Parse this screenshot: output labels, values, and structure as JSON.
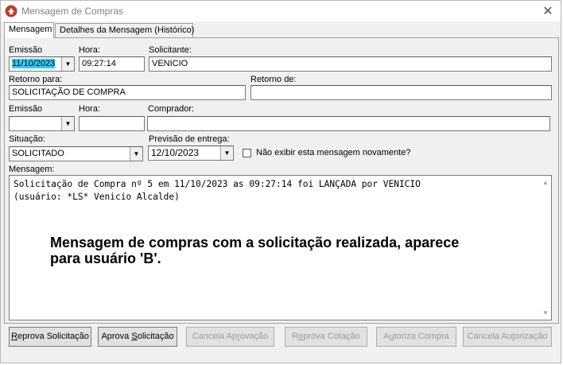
{
  "window": {
    "title": "Mensagem de Compras",
    "close_glyph": "✕"
  },
  "tabs": [
    {
      "label": "Mensagem"
    },
    {
      "label": "Detalhes da Mensagem (Histórico)"
    }
  ],
  "form": {
    "emissao_label": "Emissão",
    "emissao_value": "11/10/2023",
    "hora_label": "Hora:",
    "hora_value": "09:27:14",
    "solicitante_label": "Solicitante:",
    "solicitante_value": "VENICIO",
    "retorno_para_label": "Retorno para:",
    "retorno_para_value": "SOLICITAÇÃO DE COMPRA",
    "retorno_de_label": "Retorno de:",
    "retorno_de_value": "",
    "emissao2_label": "Emissão",
    "emissao2_value": "",
    "hora2_label": "Hora:",
    "hora2_value": "",
    "comprador_label": "Comprador:",
    "comprador_value": "",
    "situacao_label": "Situação:",
    "situacao_value": "SOLICITADO",
    "previsao_label": "Previsão de entrega:",
    "previsao_value": "12/10/2023",
    "nao_exibir_label": "Não exibir esta mensagem novamente?",
    "mensagem_label": "Mensagem:"
  },
  "memo": {
    "line1": "Solicitação de Compra nº 5 em 11/10/2023 as 09:27:14 foi LANÇADA por VENICIO",
    "line2": "(usuário: *LS* Venicio Alcalde)"
  },
  "annotation": {
    "line1": "Mensagem de compras com a solicitação realizada, aparece",
    "line2": "para usuário 'B'."
  },
  "buttons": {
    "reprova_solicitacao": {
      "pre": "",
      "key": "R",
      "post": "eprova Solicitação"
    },
    "aprova_solicitacao": {
      "pre": "Aprova ",
      "key": "S",
      "post": "olicitação"
    },
    "cancela_aprovacao": {
      "pre": "Cancela Ap",
      "key": "r",
      "post": "ovação"
    },
    "reprova_cotacao": {
      "pre": "R",
      "key": "e",
      "post": "prova Cotação"
    },
    "autoriza_compra": {
      "pre": "A",
      "key": "u",
      "post": "toriza Compra"
    },
    "cancela_autorizacao": {
      "pre": "Cancela Au",
      "key": "t",
      "post": "orização"
    }
  },
  "colors": {
    "highlight": "#33ccff",
    "window_bg": "#f0f0f0",
    "app_icon": "#c0392b"
  },
  "icons": {
    "app": "app-logo-icon",
    "combo": "chevron-down-icon",
    "scroll_up": "scroll-up-icon",
    "scroll_down": "scroll-down-icon"
  }
}
